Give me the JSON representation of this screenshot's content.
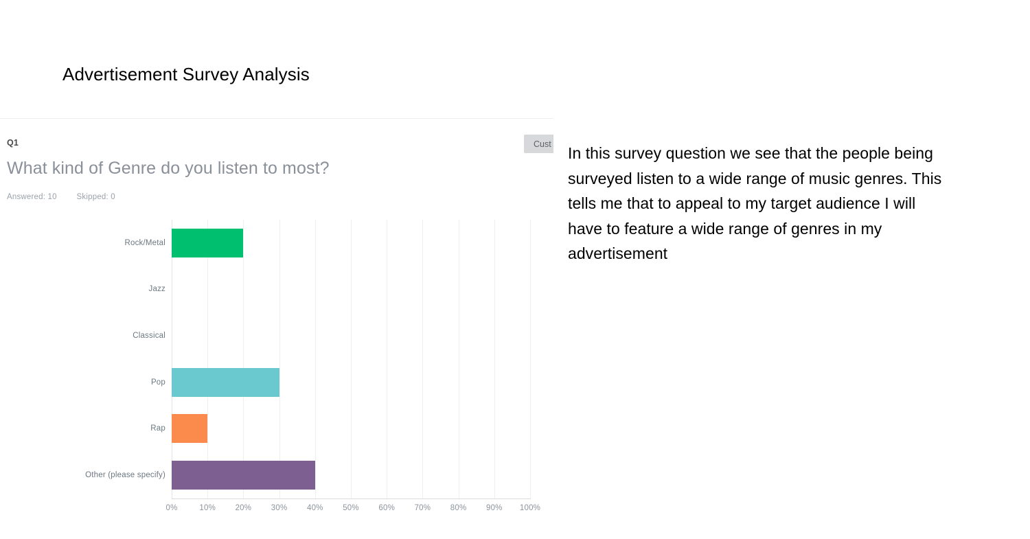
{
  "slide": {
    "title": "Advertisement Survey Analysis"
  },
  "survey": {
    "question_number": "Q1",
    "question_title": "What kind of Genre do you listen to most?",
    "answered_label": "Answered: 10",
    "skipped_label": "Skipped: 0",
    "customize_button": "Cust",
    "customize_button_full": "Customize"
  },
  "commentary": {
    "text": "In this survey question we see that the people being surveyed listen to a wide range of music genres. This tells me that to appeal to my target audience I will have to feature a wide range of genres in my advertisement"
  },
  "chart_data": {
    "type": "bar",
    "orientation": "horizontal",
    "title": "What kind of Genre do you listen to most?",
    "xlabel": "",
    "ylabel": "",
    "xlim": [
      0,
      100
    ],
    "xunit": "%",
    "grid": true,
    "legend": false,
    "categories": [
      "Rock/Metal",
      "Jazz",
      "Classical",
      "Pop",
      "Rap",
      "Other (please specify)"
    ],
    "values": [
      20,
      0,
      0,
      30,
      10,
      40
    ],
    "colors": [
      "#00bf6f",
      "#f5a623",
      "#4a90d9",
      "#69c9ce",
      "#fb8b4c",
      "#7d5f91"
    ],
    "xticks": [
      "0%",
      "10%",
      "20%",
      "30%",
      "40%",
      "50%",
      "60%",
      "70%",
      "80%",
      "90%",
      "100%"
    ],
    "xtick_values": [
      0,
      10,
      20,
      30,
      40,
      50,
      60,
      70,
      80,
      90,
      100
    ]
  }
}
